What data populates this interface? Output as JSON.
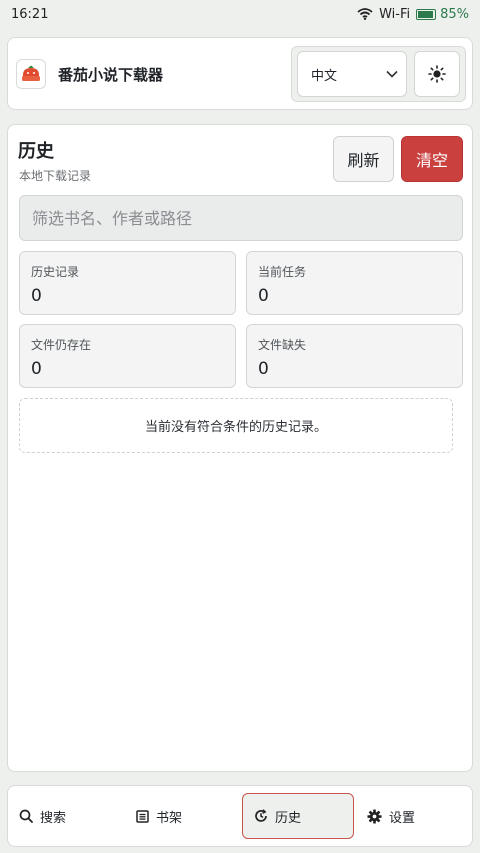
{
  "status_bar": {
    "time": "16:21",
    "network": "Wi-Fi",
    "battery": "85%",
    "battery_level": 0.85
  },
  "header": {
    "app_title": "番茄小说下载器",
    "language_selected": "中文",
    "logo_icon": "tomato-logo-icon",
    "theme_icon": "sun-icon"
  },
  "history": {
    "title": "历史",
    "subtitle": "本地下载记录",
    "refresh_label": "刷新",
    "clear_label": "清空",
    "filter_placeholder": "筛选书名、作者或路径",
    "stats": [
      {
        "label": "历史记录",
        "value": "0"
      },
      {
        "label": "当前任务",
        "value": "0"
      },
      {
        "label": "文件仍存在",
        "value": "0"
      },
      {
        "label": "文件缺失",
        "value": "0"
      }
    ],
    "empty_message": "当前没有符合条件的历史记录。"
  },
  "nav": {
    "items": [
      {
        "label": "搜索",
        "icon": "search-icon"
      },
      {
        "label": "书架",
        "icon": "list-icon"
      },
      {
        "label": "历史",
        "icon": "history-icon",
        "active": true
      },
      {
        "label": "设置",
        "icon": "gear-icon"
      }
    ]
  },
  "colors": {
    "accent_red": "#c9403f",
    "battery_green": "#2c7a4b",
    "background": "#eef0ee"
  }
}
